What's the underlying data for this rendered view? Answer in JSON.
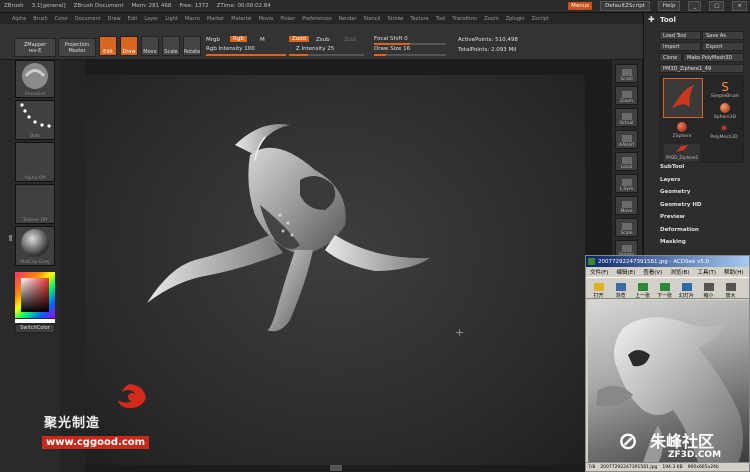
{
  "titlebar": {
    "app": "ZBrush",
    "version": "3.1[general]",
    "document": "ZBrush Document",
    "mem": "Mem: 281 468",
    "free": "Free: 1372",
    "ztime": "ZTime: 00:00:02.84",
    "menus_btn": "Menus",
    "default_script": "DefaultZScript",
    "help": "Help"
  },
  "menubar": [
    "Alpha",
    "Brush",
    "Color",
    "Document",
    "Draw",
    "Edit",
    "Layer",
    "Light",
    "Macro",
    "Marker",
    "Material",
    "Movie",
    "Picker",
    "Preferences",
    "Render",
    "Stencil",
    "Stroke",
    "Texture",
    "Tool",
    "Transform",
    "Zoom",
    "Zplugin",
    "Zscript"
  ],
  "toolbar": {
    "zmapper": "ZMapper",
    "zmapper_sub": "rev-E",
    "projection": "Projection",
    "projection_sub": "Master",
    "edit": "Edit",
    "draw": "Draw",
    "move": "Move",
    "scale": "Scale",
    "rotate": "Rotate",
    "mrgb": "Mrgb",
    "rgb": "Rgb",
    "m": "M",
    "zadd": "Zadd",
    "zsub": "Zsub",
    "zcut": "Zcut",
    "rgb_intensity": "Rgb Intensity 100",
    "z_intensity": "Z Intensity 25",
    "focal_shift": "Focal Shift 0",
    "draw_size": "Draw Size 16",
    "active_points": "ActivePoints: 510,498",
    "total_points": "TotalPoints: 2.093 Mil",
    "rgb_intensity_pct": 100,
    "z_intensity_pct": 25,
    "focal_shift_pct": 50,
    "draw_size_pct": 16
  },
  "leftshelf": {
    "standard": "Standard",
    "dots": "Dots",
    "alpha": "Alpha Off",
    "texture": "Texture Off",
    "material": "MatCap Gray",
    "switch_color": "SwitchColor"
  },
  "rightshelf": [
    "Scroll",
    "Zoom",
    "Actual",
    "AAHalf",
    "Local",
    "L.Sym",
    "Move",
    "Scale",
    "Rotate",
    "Solo"
  ],
  "tool": {
    "header": "Tool",
    "load": "Load Tool",
    "save": "Save As",
    "import": "Import",
    "export": "Export",
    "clone": "Clone",
    "make_polymesh": "Make PolyMesh3D",
    "current": "PM3D_Ziphere1_49",
    "current_value": "49",
    "brushes": [
      "SimpleBrush",
      "Sphere3D",
      "ZSphere",
      "PolyMesh3D",
      "PM3D_Zsphere1"
    ],
    "sections": [
      "SubTool",
      "Layers",
      "Geometry",
      "Geometry HD",
      "Preview",
      "Deformation",
      "Masking"
    ]
  },
  "acdsee": {
    "title": "20077292247391581.jpg - ACDSee v5.0",
    "menu": [
      "文件(F)",
      "编辑(E)",
      "查看(V)",
      "浏览(B)",
      "工具(T)",
      "帮助(H)"
    ],
    "tools": [
      "打开",
      "浏览",
      "上一张",
      "下一张",
      "幻灯片",
      "缩小",
      "放大"
    ],
    "status_index": "7/8",
    "status_file": "20077292247391581.jpg",
    "status_size": "194.3 KB",
    "status_dims": "900x665x24b"
  },
  "watermark": {
    "cn": "聚光制造",
    "url": "www.cggood.com",
    "site": "朱峰社区",
    "site_url": "ZF3D.COM"
  },
  "colors": {
    "accent": "#d9661e",
    "zb_bg": "#2b2b2b"
  }
}
